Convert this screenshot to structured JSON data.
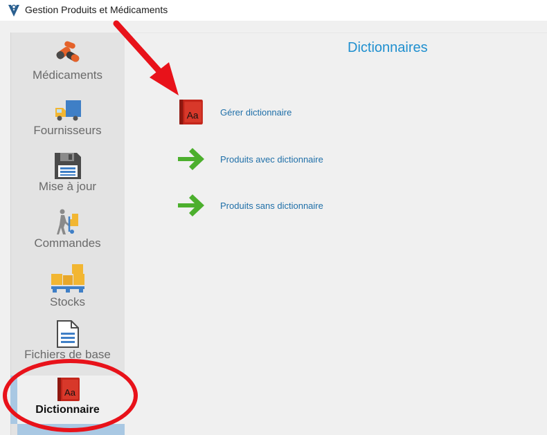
{
  "window": {
    "title": "Gestion Produits et Médicaments"
  },
  "sidebar": {
    "items": [
      {
        "label": "Médicaments",
        "icon": "pills-icon"
      },
      {
        "label": "Fournisseurs",
        "icon": "truck-icon"
      },
      {
        "label": "Mise à jour",
        "icon": "floppy-disk-icon"
      },
      {
        "label": "Commandes",
        "icon": "hand-truck-icon"
      },
      {
        "label": "Stocks",
        "icon": "pallet-boxes-icon"
      },
      {
        "label": "Fichiers de base",
        "icon": "document-icon"
      },
      {
        "label": "Dictionnaire",
        "icon": "dictionary-book-icon",
        "active": true
      }
    ]
  },
  "main": {
    "title": "Dictionnaires",
    "actions": [
      {
        "label": "Gérer dictionnaire",
        "icon": "dictionary-book-icon"
      },
      {
        "label": "Produits avec dictionnaire",
        "icon": "green-arrow-icon"
      },
      {
        "label": "Produits sans dictionnaire",
        "icon": "green-arrow-icon"
      }
    ]
  },
  "annotations": {
    "color": "#e8121a"
  },
  "colors": {
    "accent": "#1e8fcf",
    "link": "#1f6fa8",
    "arrow_green": "#4caf2d"
  }
}
